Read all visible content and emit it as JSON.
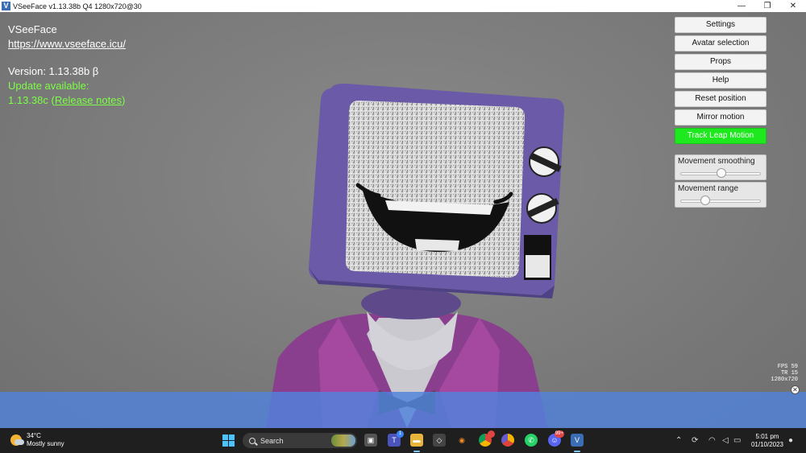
{
  "window": {
    "icon_letter": "V",
    "title": "VSeeFace v1.13.38b Q4 1280x720@30",
    "minimize": "—",
    "restore": "❐",
    "close": "✕"
  },
  "info": {
    "app_name": "VSeeFace",
    "website": "https://www.vseeface.icu/",
    "version": "Version: 1.13.38b β",
    "update_available": "Update available:",
    "update_version": "1.13.38c (",
    "release_notes": "Release notes",
    "update_suffix": ")"
  },
  "panel": {
    "buttons": [
      {
        "label": "Settings"
      },
      {
        "label": "Avatar selection"
      },
      {
        "label": "Props"
      },
      {
        "label": "Help"
      },
      {
        "label": "Reset position"
      },
      {
        "label": "Mirror motion"
      },
      {
        "label": "Track Leap Motion",
        "active": true
      }
    ],
    "sliders": [
      {
        "label": "Movement smoothing",
        "value": 0.5
      },
      {
        "label": "Movement range",
        "value": 0.3
      }
    ]
  },
  "stats": {
    "fps": "FPS  59",
    "tr": "TR  15",
    "resolution": "1280x720"
  },
  "overlay": {
    "close": "✕"
  },
  "taskbar": {
    "weather_temp": "34°C",
    "weather_desc": "Mostly sunny",
    "search_label": "Search",
    "teams_badge": "1",
    "discord_badge": "99+",
    "clock_time": "5:01 pm",
    "clock_date": "01/10/2023"
  },
  "colors": {
    "accent_green": "#1ee81e",
    "update_green": "#7cff45",
    "overlay_blue": "#5082dc"
  }
}
